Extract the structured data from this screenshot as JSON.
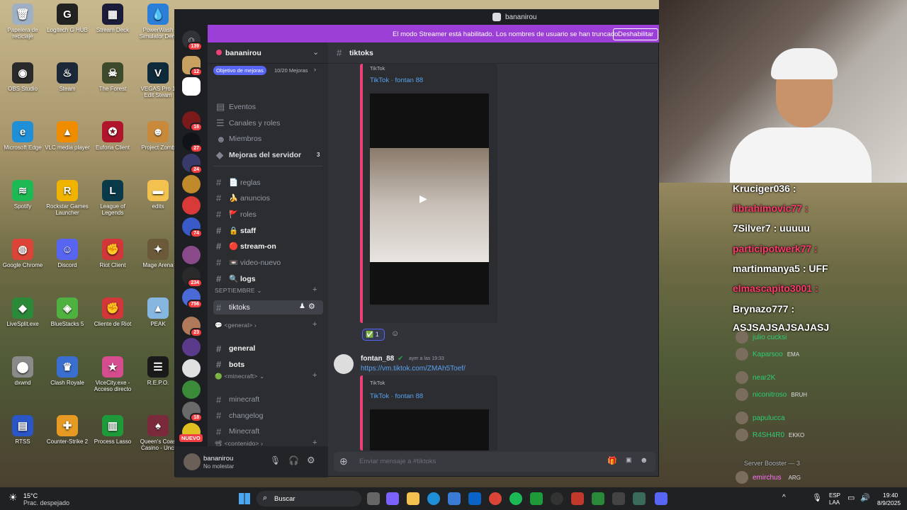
{
  "desktop": {
    "icons": [
      {
        "label": "Papelera de reciclaje",
        "icon": "recycle-bin-icon",
        "color": "#9fb0c4",
        "glyph": "🗑"
      },
      {
        "label": "Logitech G HUB",
        "icon": "logitech-icon",
        "color": "#222222",
        "glyph": "G"
      },
      {
        "label": "Stream Deck",
        "icon": "stream-deck-icon",
        "color": "#1a1c3a",
        "glyph": "▦"
      },
      {
        "label": "PowerWash Simulator Dem",
        "icon": "powerwash-icon",
        "color": "#2c7fd8",
        "glyph": "💧"
      },
      {
        "label": "OBS Studio",
        "icon": "obs-icon",
        "color": "#2a2a2a",
        "glyph": "◉"
      },
      {
        "label": "Steam",
        "icon": "steam-icon",
        "color": "#1b2838",
        "glyph": "♨"
      },
      {
        "label": "The Forest",
        "icon": "the-forest-icon",
        "color": "#3e4a2c",
        "glyph": "☠"
      },
      {
        "label": "VEGAS Pro 1 Edit Steam",
        "icon": "vegas-icon",
        "color": "#0e2a3a",
        "glyph": "V"
      },
      {
        "label": "Microsoft Edge",
        "icon": "edge-icon",
        "color": "#1f8fd8",
        "glyph": "e"
      },
      {
        "label": "VLC media player",
        "icon": "vlc-icon",
        "color": "#f08c00",
        "glyph": "▲"
      },
      {
        "label": "Euforia Client",
        "icon": "euforia-icon",
        "color": "#b0152b",
        "glyph": "✪"
      },
      {
        "label": "Project Zomb",
        "icon": "project-zomboid-icon",
        "color": "#c88a3a",
        "glyph": "☻"
      },
      {
        "label": "Spotify",
        "icon": "spotify-icon",
        "color": "#1db954",
        "glyph": "≋"
      },
      {
        "label": "Rockstar Games Launcher",
        "icon": "rockstar-icon",
        "color": "#f0b400",
        "glyph": "R"
      },
      {
        "label": "League of Legends",
        "icon": "league-icon",
        "color": "#0a3a4a",
        "glyph": "L"
      },
      {
        "label": "edits",
        "icon": "folder-icon",
        "color": "#f2c14e",
        "glyph": "▬"
      },
      {
        "label": "Google Chrome",
        "icon": "chrome-icon",
        "color": "#db4437",
        "glyph": "◍"
      },
      {
        "label": "Discord",
        "icon": "discord-icon",
        "color": "#5865f2",
        "glyph": "☺"
      },
      {
        "label": "Riot Client",
        "icon": "riot-client-icon",
        "color": "#d13639",
        "glyph": "✊"
      },
      {
        "label": "Mage Arena",
        "icon": "mage-arena-icon",
        "color": "#6a5a3a",
        "glyph": "✦"
      },
      {
        "label": "LiveSplit.exe",
        "icon": "livesplit-icon",
        "color": "#2a8a3a",
        "glyph": "◆"
      },
      {
        "label": "BlueStacks 5",
        "icon": "bluestacks-icon",
        "color": "#4fb13f",
        "glyph": "◈"
      },
      {
        "label": "Cliente de Riot",
        "icon": "riot-client-icon",
        "color": "#d13639",
        "glyph": "✊"
      },
      {
        "label": "PEAK",
        "icon": "peak-icon",
        "color": "#86b7e0",
        "glyph": "▲"
      },
      {
        "label": "dxwnd",
        "icon": "dxwnd-icon",
        "color": "#8a8a8a",
        "glyph": "⬤"
      },
      {
        "label": "Clash Royale",
        "icon": "clash-royale-icon",
        "color": "#3a6fd0",
        "glyph": "♛"
      },
      {
        "label": "ViceCity.exe - Acceso directo",
        "icon": "vicecity-icon",
        "color": "#d54c8f",
        "glyph": "★"
      },
      {
        "label": "R.E.P.O.",
        "icon": "repo-icon",
        "color": "#1a1a1a",
        "glyph": "☰"
      },
      {
        "label": "RTSS",
        "icon": "rtss-icon",
        "color": "#2a56c8",
        "glyph": "▤"
      },
      {
        "label": "Counter-Strike 2",
        "icon": "cs2-icon",
        "color": "#e69a24",
        "glyph": "✚"
      },
      {
        "label": "Process Lasso",
        "icon": "process-lasso-icon",
        "color": "#1f9a3a",
        "glyph": "▥"
      },
      {
        "label": "Queen's Coas Casino - Unci",
        "icon": "casino-icon",
        "color": "#7a2a3a",
        "glyph": "♠"
      }
    ]
  },
  "discord": {
    "title": "bananirou",
    "streamer_banner": "El modo Streamer está habilitado. Los nombres de usuario se han truncado.",
    "disable_button": "Deshabilitar",
    "server": {
      "name": "bananirou",
      "boost_goal": "Objetivo de mejoras",
      "boost_count": "10/20 Mejoras",
      "menu": [
        "Eventos",
        "Canales y roles",
        "Miembros"
      ],
      "boosts_label": "Mejoras del servidor",
      "boosts_count": "3"
    },
    "guild_badges": [
      "139",
      "12",
      "16",
      "27",
      "24",
      "74",
      "234",
      "756",
      "23",
      "18"
    ],
    "new_label": "NUEVO",
    "channels": [
      {
        "name": "📄 reglas"
      },
      {
        "name": "🍌 anuncios"
      },
      {
        "name": "🚩 roles"
      },
      {
        "name": "🔒 staff",
        "bold": true
      },
      {
        "name": "🔴 stream-on",
        "bold": true
      },
      {
        "name": "📼 video-nuevo"
      },
      {
        "name": "🔍 logs",
        "bold": true
      }
    ],
    "category_sept": "SEPTIEMBRE",
    "active_channel": "tiktoks",
    "category_general": "<general>",
    "general_channels": [
      {
        "name": "general",
        "bold": true
      },
      {
        "name": "bots",
        "bold": true
      }
    ],
    "category_minecraft": "<minecraft>",
    "minecraft_channels": [
      {
        "name": "minecraft"
      },
      {
        "name": "changelog"
      },
      {
        "name": "Minecraft"
      }
    ],
    "category_contenido": "<contenido>",
    "user": {
      "name": "bananirou",
      "status": "No molestar"
    },
    "channel_header": "tiktoks",
    "messages": {
      "embed1_provider": "TikTok",
      "embed1_title": "TikTok · fontan 88",
      "reaction_emoji": "✅",
      "reaction_count": "1",
      "author": "fontan_88",
      "timestamp": "ayer a las 19:33",
      "link": "https://vm.tiktok.com/ZMAh5Toef/",
      "embed2_provider": "TikTok",
      "embed2_title": "TikTok · fontan 88"
    },
    "composer_placeholder": "Enviar mensaje a #tiktoks"
  },
  "stream_chat": {
    "lines": [
      "Kruciger036 :",
      "iibrahimovic77 :",
      "7Silver7 : uuuuu",
      "participotwerk77 :",
      "martinmanya5 : UFF",
      "elmascapito3001 :",
      "Brynazo777 :",
      "ASJSAJSAJSAJASJ"
    ]
  },
  "members": {
    "list": [
      {
        "name": "julio cucksi",
        "tag": ""
      },
      {
        "name": "Kaparsoo",
        "tag": "EMA"
      },
      {
        "name": "near2K",
        "tag": ""
      },
      {
        "name": "niconitroso",
        "tag": "BRUH"
      },
      {
        "name": "papulucca",
        "tag": ""
      },
      {
        "name": "R4SH4R0",
        "tag": "EKKO"
      }
    ],
    "section_booster": "Server Booster — 3",
    "last_member": "emirchus",
    "last_tag": "ARG"
  },
  "taskbar": {
    "temp": "15°C",
    "weather": "Prac. despejado",
    "search": "Buscar",
    "lang1": "ESP",
    "lang2": "LAA",
    "time": "19:40",
    "date": "8/9/2025"
  }
}
